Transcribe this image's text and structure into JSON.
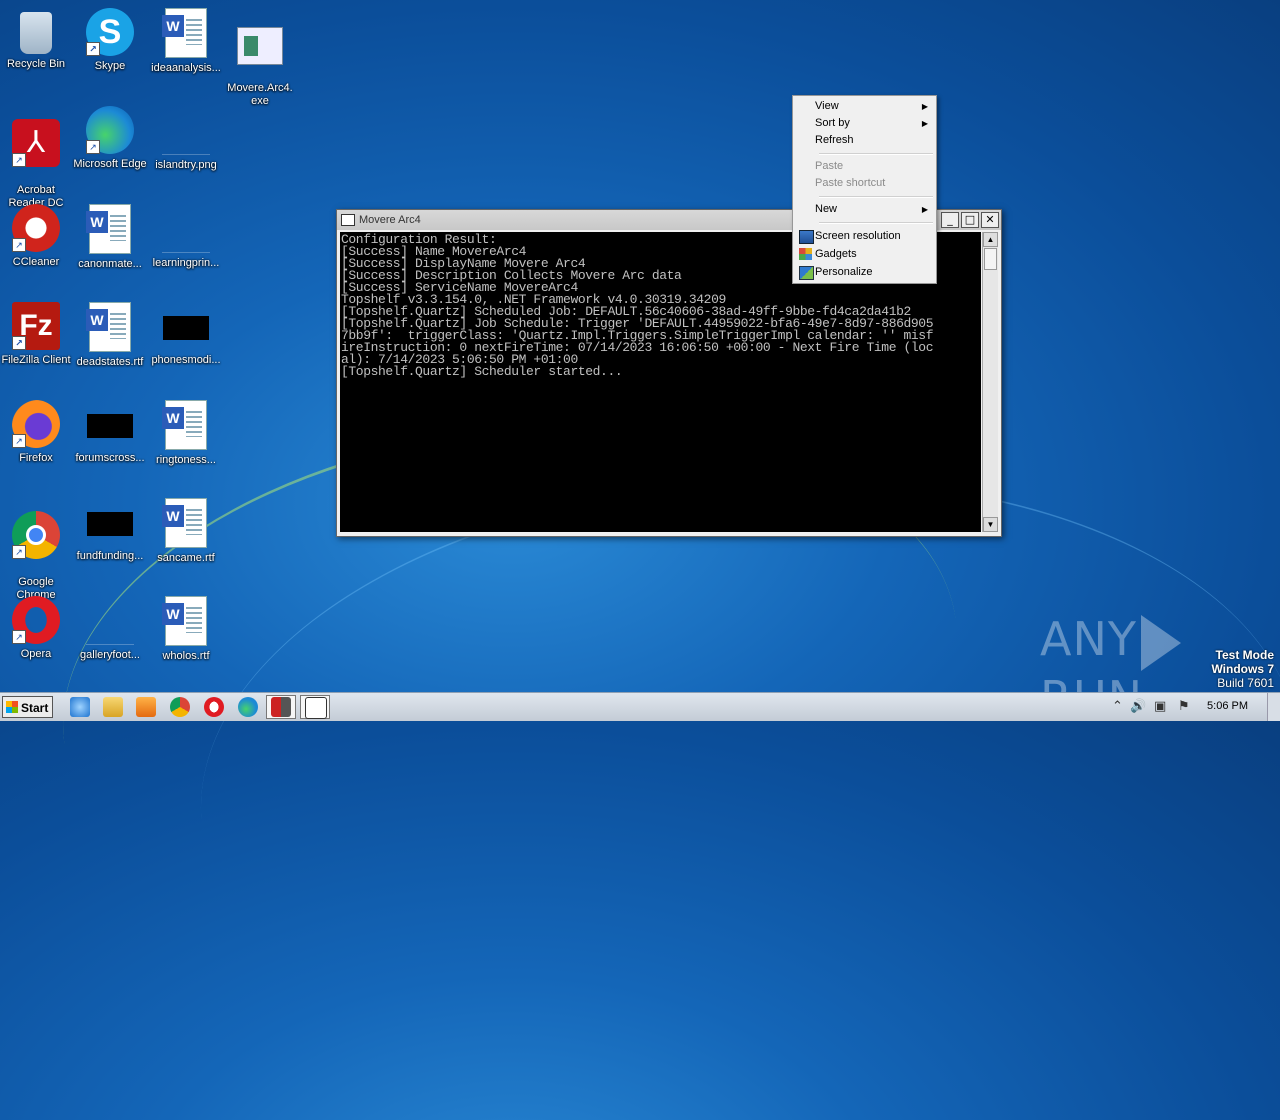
{
  "desktop": {
    "icons": [
      {
        "label": "Recycle Bin"
      },
      {
        "label": "Skype"
      },
      {
        "label": "ideaanalysis..."
      },
      {
        "label": "Movere.Arc4.\nexe"
      },
      {
        "label": "Acrobat\nReader DC"
      },
      {
        "label": "Microsoft Edge"
      },
      {
        "label": "islandtry.png"
      },
      {
        "label": "CCleaner"
      },
      {
        "label": "canonmate..."
      },
      {
        "label": "learningprin..."
      },
      {
        "label": "FileZilla Client"
      },
      {
        "label": "deadstates.rtf"
      },
      {
        "label": "phonesmodi..."
      },
      {
        "label": "Firefox"
      },
      {
        "label": "forumscross..."
      },
      {
        "label": "ringtoness..."
      },
      {
        "label": "Google\nChrome"
      },
      {
        "label": "fundfunding..."
      },
      {
        "label": "sancame.rtf"
      },
      {
        "label": "Opera"
      },
      {
        "label": "galleryfoot..."
      },
      {
        "label": "wholos.rtf"
      }
    ]
  },
  "console": {
    "title": "Movere Arc4",
    "lines": [
      "Configuration Result:",
      "[Success] Name MovereArc4",
      "[Success] DisplayName Movere Arc4",
      "[Success] Description Collects Movere Arc data",
      "[Success] ServiceName MovereArc4",
      "Topshelf v3.3.154.0, .NET Framework v4.0.30319.34209",
      "[Topshelf.Quartz] Scheduled Job: DEFAULT.56c40606-38ad-49ff-9bbe-fd4ca2da41b2",
      "[Topshelf.Quartz] Job Schedule: Trigger 'DEFAULT.44959022-bfa6-49e7-8d97-886d905",
      "7bb9f':  triggerClass: 'Quartz.Impl.Triggers.SimpleTriggerImpl calendar: '' misf",
      "ireInstruction: 0 nextFireTime: 07/14/2023 16:06:50 +00:00 - Next Fire Time (loc",
      "al): 7/14/2023 5:06:50 PM +01:00",
      "[Topshelf.Quartz] Scheduler started..."
    ]
  },
  "context_menu": {
    "items": [
      {
        "label": "View",
        "submenu": true,
        "disabled": false
      },
      {
        "label": "Sort by",
        "submenu": true,
        "disabled": false
      },
      {
        "label": "Refresh",
        "submenu": false,
        "disabled": false
      },
      {
        "label": "Paste",
        "submenu": false,
        "disabled": true
      },
      {
        "label": "Paste shortcut",
        "submenu": false,
        "disabled": true
      },
      {
        "label": "New",
        "submenu": true,
        "disabled": false
      },
      {
        "label": "Screen resolution",
        "icon": "screen-resolution-icon",
        "disabled": false
      },
      {
        "label": "Gadgets",
        "icon": "gadgets-icon",
        "disabled": false
      },
      {
        "label": "Personalize",
        "icon": "personalize-icon",
        "disabled": false
      }
    ]
  },
  "watermark": {
    "text_left": "ANY",
    "text_right": "RUN"
  },
  "testmode": {
    "line1": "Test Mode",
    "line2": "Windows 7",
    "line3": "Build 7601"
  },
  "taskbar": {
    "start_label": "Start",
    "clock": "5:06 PM"
  }
}
